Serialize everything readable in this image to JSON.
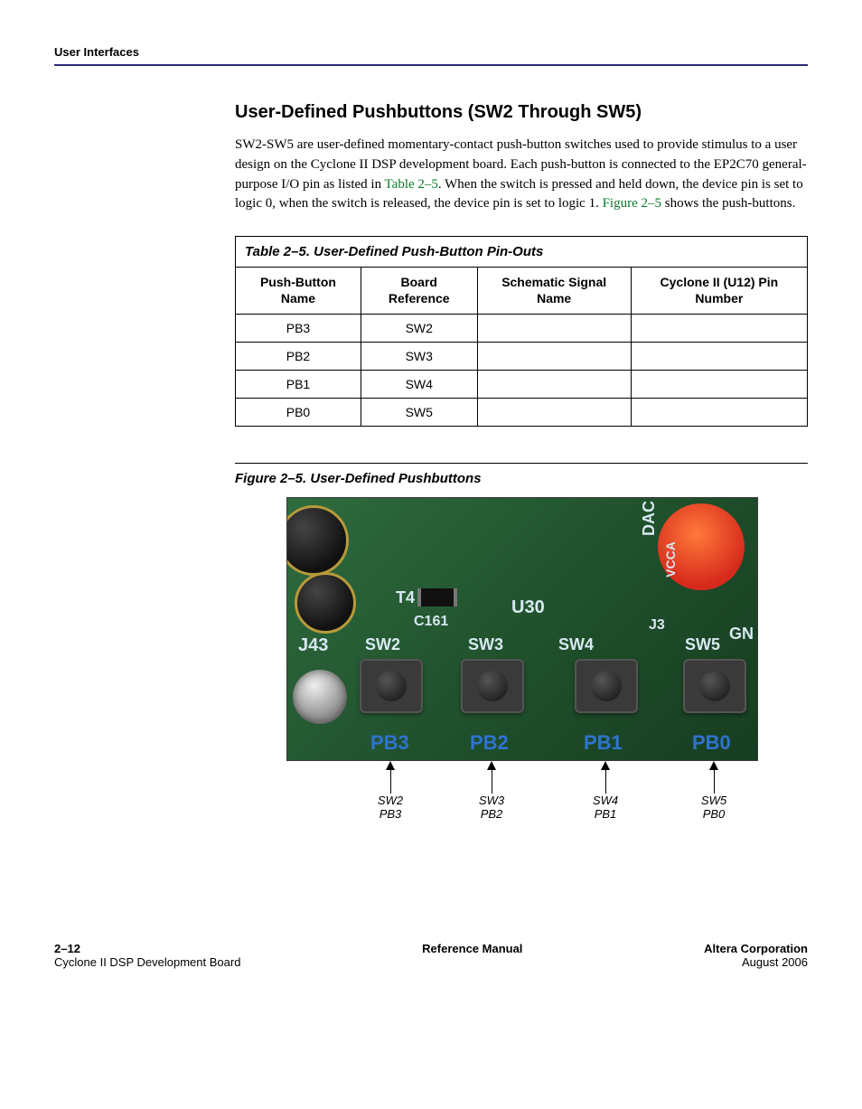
{
  "running_head": "User Interfaces",
  "section_title": "User-Defined Pushbuttons (SW2 Through SW5)",
  "body_segments": [
    "SW2-SW5 are user-defined momentary-contact push-button switches used to provide stimulus to a user design on the Cyclone II DSP development board. Each push-button is connected to the EP2C70 general-purpose I/O pin as listed in ",
    ". When the switch is pressed and held down, the device pin is set to logic 0, when the switch is released, the device pin is set to logic 1. ",
    " shows the push-buttons."
  ],
  "xref_table": "Table 2–5",
  "xref_figure": "Figure 2–5",
  "table": {
    "caption": "Table 2–5. User-Defined Push-Button Pin-Outs",
    "headers": [
      "Push-Button Name",
      "Board Reference",
      "Schematic Signal Name",
      "Cyclone II (U12) Pin Number"
    ],
    "rows": [
      [
        "PB3",
        "SW2",
        "",
        ""
      ],
      [
        "PB2",
        "SW3",
        "",
        ""
      ],
      [
        "PB1",
        "SW4",
        "",
        ""
      ],
      [
        "PB0",
        "SW5",
        "",
        ""
      ]
    ]
  },
  "figure": {
    "caption": "Figure 2–5. User-Defined Pushbuttons",
    "silk": {
      "j43": "J43",
      "t4": "T4",
      "c161": "C161",
      "u30": "U30",
      "j3": "J3",
      "dac": "DAC",
      "vcca": "VCCA",
      "gn": "GN",
      "sw2": "SW2",
      "sw3": "SW3",
      "sw4": "SW4",
      "sw5": "SW5",
      "pb3": "PB3",
      "pb2": "PB2",
      "pb1": "PB1",
      "pb0": "PB0"
    },
    "callouts": [
      {
        "top": "SW2",
        "bottom": "PB3"
      },
      {
        "top": "SW3",
        "bottom": "PB2"
      },
      {
        "top": "SW4",
        "bottom": "PB1"
      },
      {
        "top": "SW5",
        "bottom": "PB0"
      }
    ]
  },
  "footer": {
    "left_line1": "2–12",
    "left_line2": "Cyclone II DSP Development Board",
    "center_line1": "Reference Manual",
    "right_line1": "Altera Corporation",
    "right_line2": "August 2006"
  }
}
